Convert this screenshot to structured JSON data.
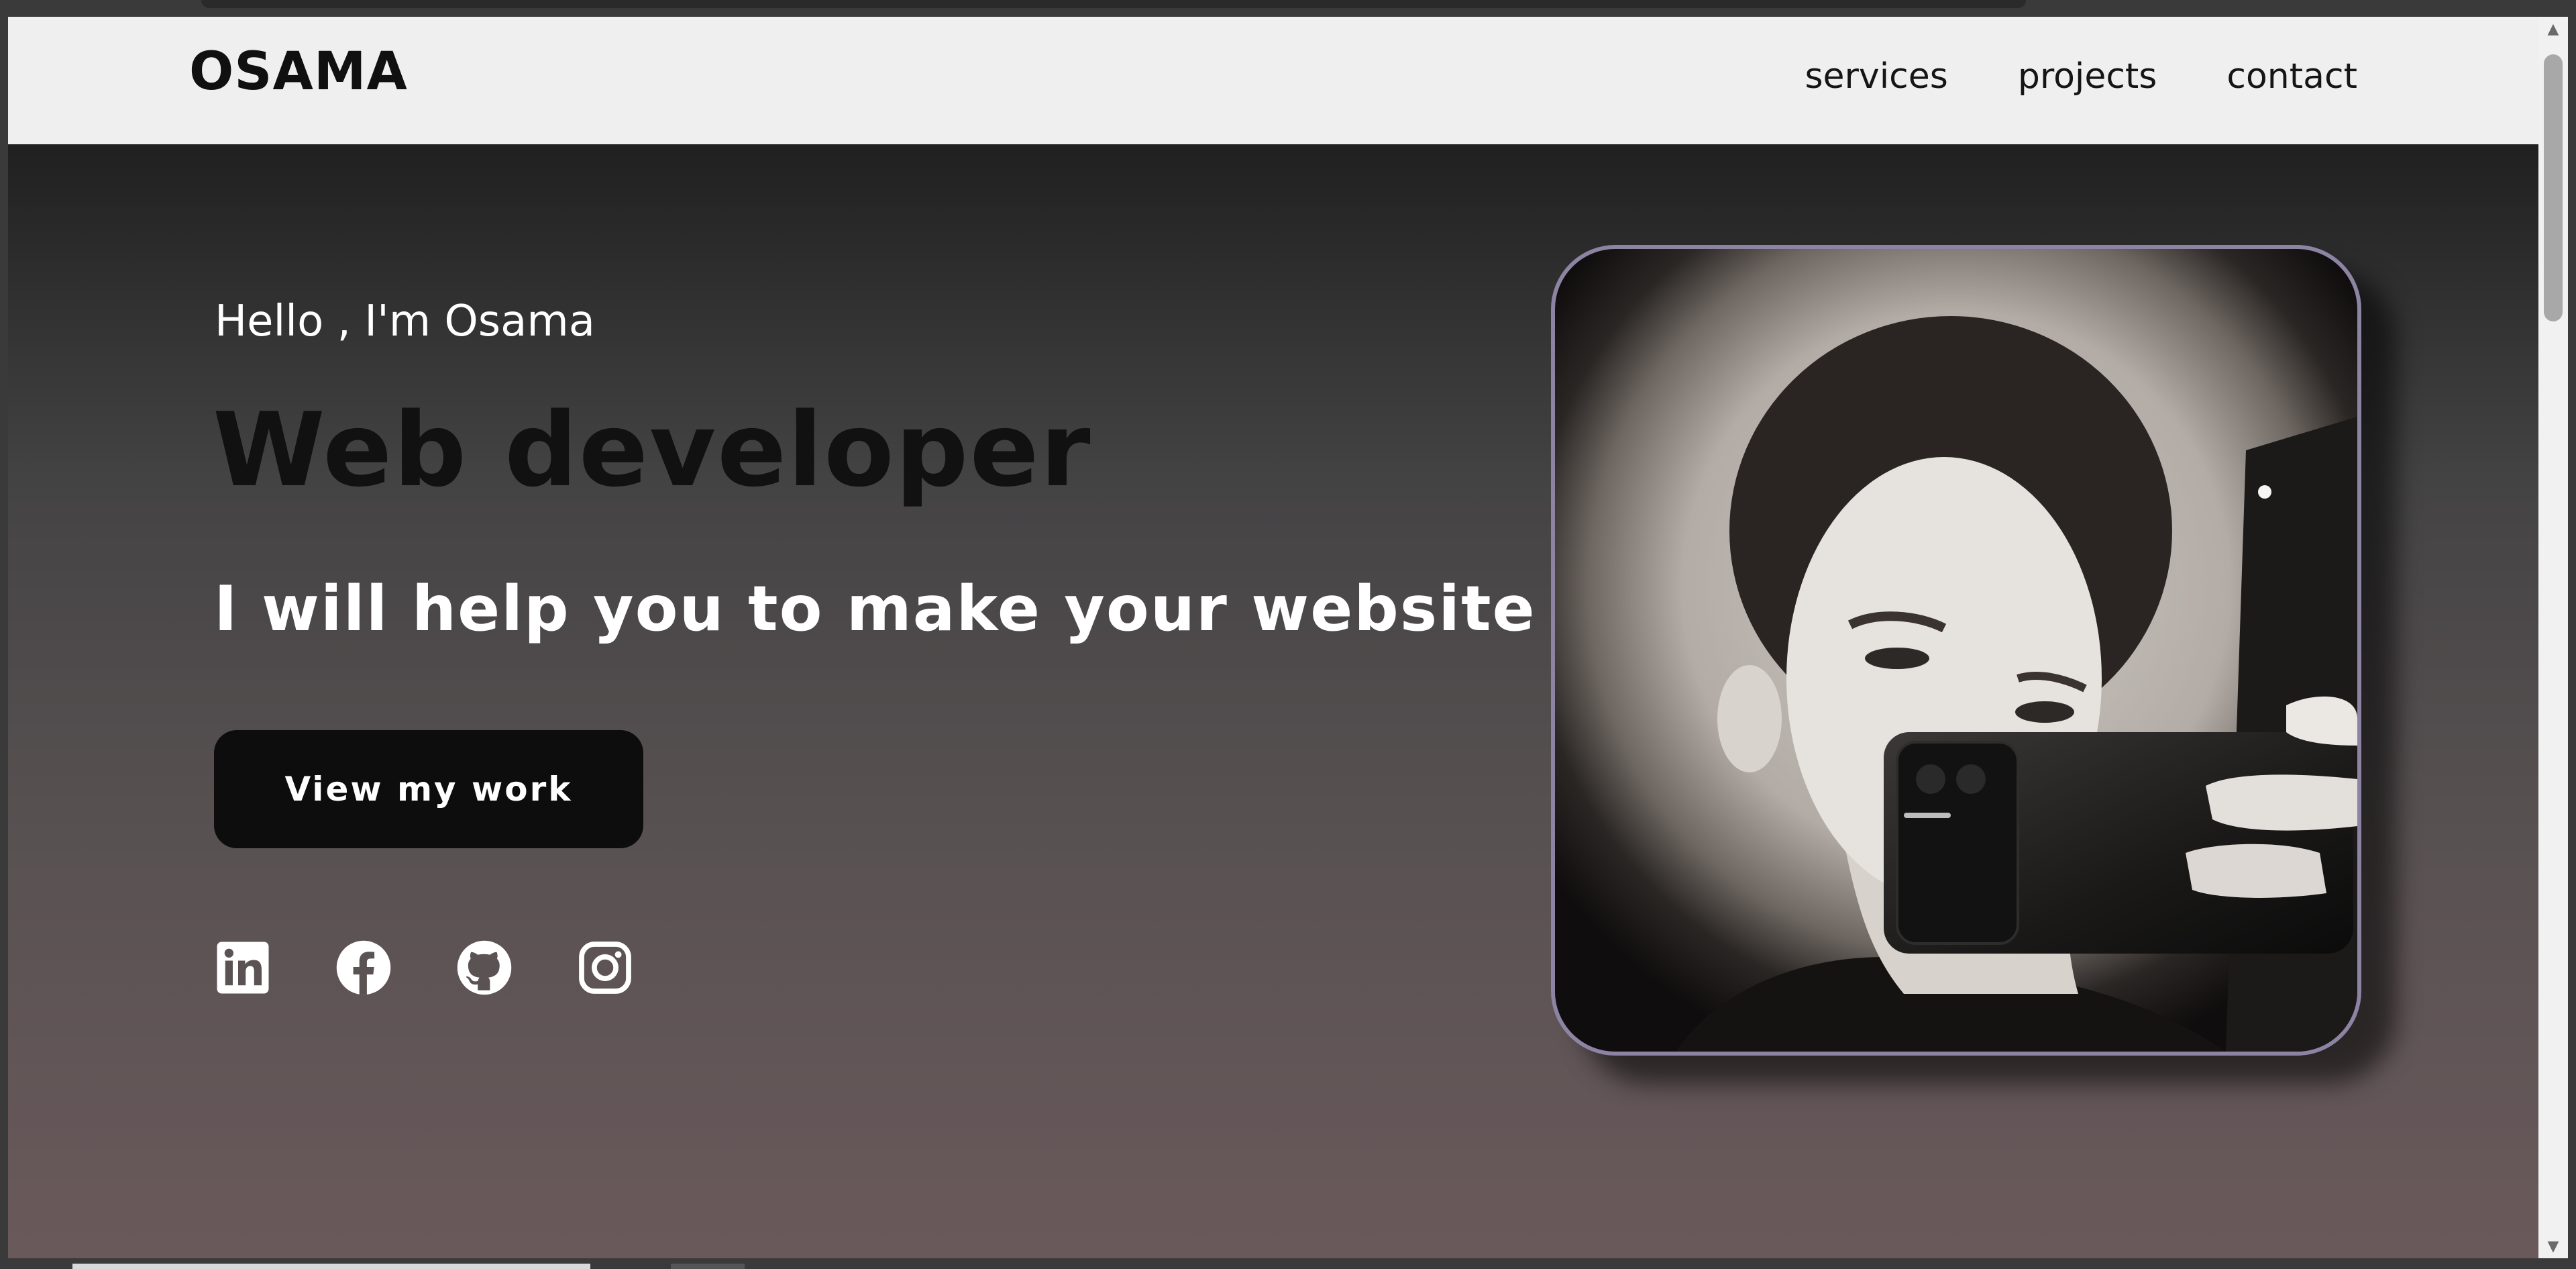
{
  "header": {
    "logo": "OSAMA",
    "nav": [
      "services",
      "projects",
      "contact"
    ]
  },
  "hero": {
    "greeting": "Hello , I'm Osama",
    "title": "Web developer",
    "tagline": "I will help you to make your website",
    "cta_label": "View my work",
    "socials": [
      {
        "icon": "linkedin-icon"
      },
      {
        "icon": "facebook-icon"
      },
      {
        "icon": "github-icon"
      },
      {
        "icon": "instagram-icon"
      }
    ],
    "photo_alt": "portrait photo"
  },
  "colors": {
    "header_bg": "#efefef",
    "hero_gradient_top": "#202021",
    "hero_gradient_bottom": "#6a595b",
    "button_bg": "#0d0d0d",
    "photo_border": "#8d84a4"
  }
}
